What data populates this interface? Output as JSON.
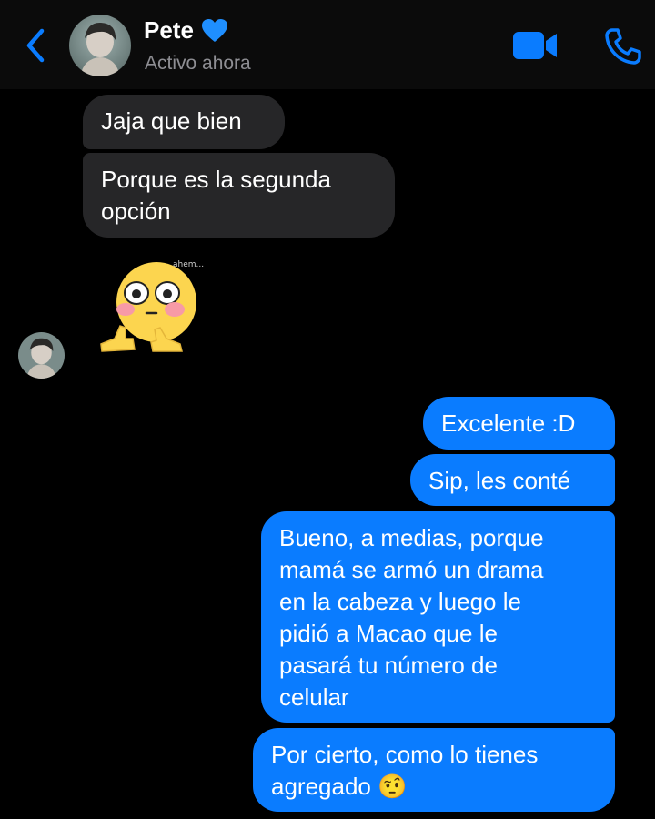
{
  "header": {
    "contact_name": "Pete",
    "heart_emoji": "💙",
    "status": "Activo ahora",
    "icons": [
      "chevron-left-icon",
      "video-camera-icon",
      "phone-icon"
    ],
    "accent_color": "#0a7cff"
  },
  "messages": [
    {
      "from": "contact",
      "text": "Jaja que bien"
    },
    {
      "from": "contact",
      "text": "Porque es la segunda\nopción"
    },
    {
      "from": "contact",
      "sticker": "blushing-emoji-thumbs-sticker",
      "sticker_caption": "ahem..."
    },
    {
      "from": "me",
      "text": "Excelente :D"
    },
    {
      "from": "me",
      "text": "Sip, les conté"
    },
    {
      "from": "me",
      "text": "Bueno, a medias, porque\nmamá se armó un drama\nen la cabeza y luego le\npidió a Macao que le\npasará tu número de\ncelular"
    },
    {
      "from": "me",
      "text": "Por cierto, como lo tienes\nagregado 🤨"
    }
  ],
  "colors": {
    "incoming_bubble": "#262628",
    "outgoing_bubble": "#0a7cff",
    "background": "#000000"
  }
}
